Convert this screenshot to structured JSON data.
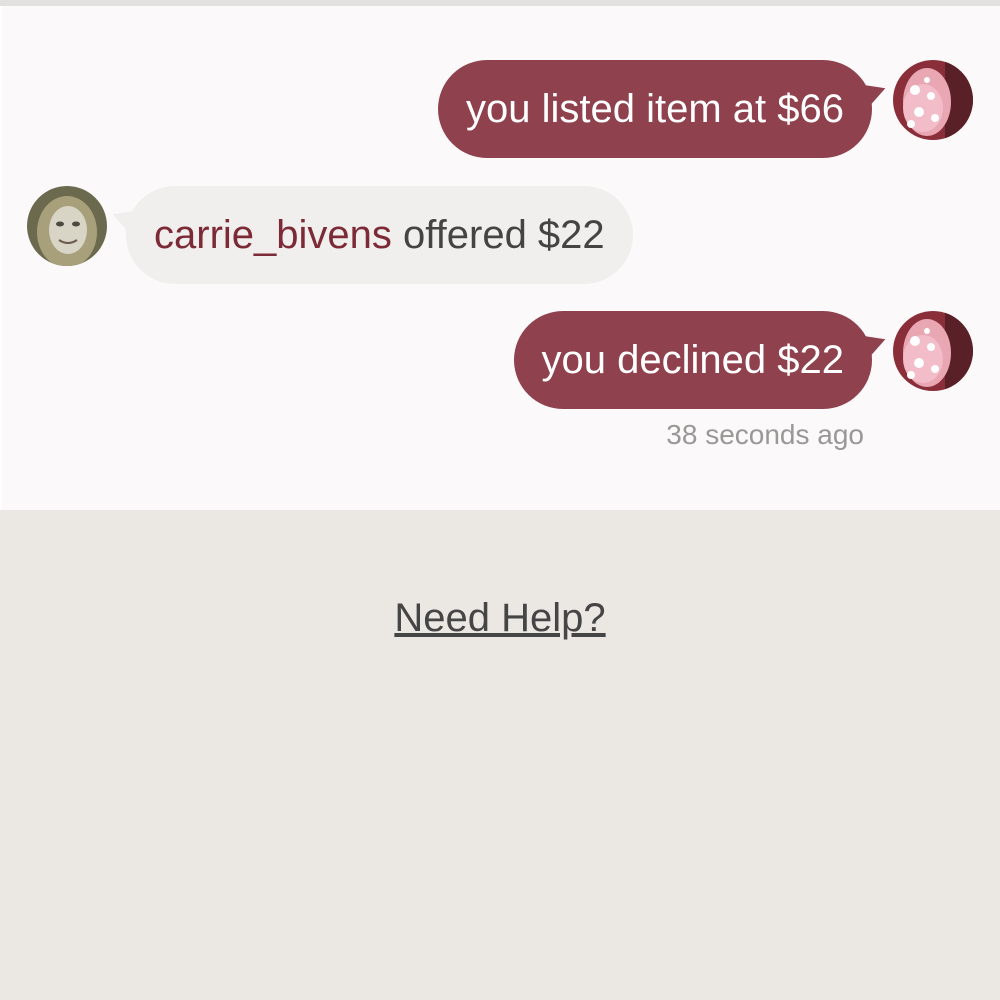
{
  "messages": [
    {
      "from": "self",
      "text": "you listed item at $66",
      "avatar": "pink-polka-dot-avatar"
    },
    {
      "from": "other",
      "username": "carrie_bivens",
      "text": " offered $22",
      "avatar": "user-photo-avatar"
    },
    {
      "from": "self",
      "text": "you declined $22",
      "avatar": "pink-polka-dot-avatar"
    }
  ],
  "timestamp": "38 seconds ago",
  "help": {
    "label": "Need Help?"
  },
  "colors": {
    "self_bubble": "#8f414d",
    "other_bubble": "#f0efed",
    "username": "#7d2a37",
    "chat_background": "#fbf9fa",
    "page_background": "#ebe8e4"
  }
}
